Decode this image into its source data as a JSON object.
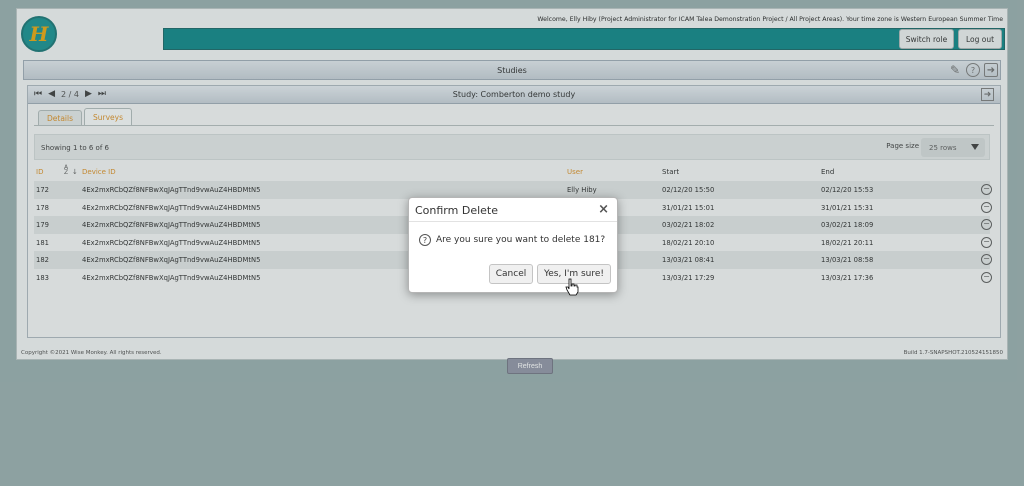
{
  "header": {
    "logo_letter": "H",
    "welcome": "Welcome, Elly Hiby (Project Administrator for ICAM Talea Demonstration Project / All Project Areas). Your time zone is Western European Summer Time",
    "switch_role": "Switch role",
    "logout": "Log out"
  },
  "panel": {
    "title": "Studies",
    "icons": [
      "pencil-icon",
      "help-icon",
      "exit-icon"
    ]
  },
  "study": {
    "pager_text": "2 / 4",
    "title": "Study: Comberton demo study"
  },
  "tabs": [
    {
      "label": "Details",
      "active": false
    },
    {
      "label": "Surveys",
      "active": true
    }
  ],
  "table": {
    "showing": "Showing 1 to 6 of 6",
    "page_size_label": "Page size",
    "page_size_value": "25 rows",
    "columns": [
      "ID",
      "Device ID",
      "User",
      "Start",
      "End"
    ],
    "rows": [
      {
        "id": "172",
        "device": "4Ex2mxRCbQZf8NFBwXqJAgTTnd9vwAuZ4HBDMtN5",
        "user": "Elly Hiby",
        "start": "02/12/20 15:50",
        "end": "02/12/20 15:53"
      },
      {
        "id": "178",
        "device": "4Ex2mxRCbQZf8NFBwXqJAgTTnd9vwAuZ4HBDMtN5",
        "user": "",
        "start": "31/01/21 15:01",
        "end": "31/01/21 15:31"
      },
      {
        "id": "179",
        "device": "4Ex2mxRCbQZf8NFBwXqJAgTTnd9vwAuZ4HBDMtN5",
        "user": "",
        "start": "03/02/21 18:02",
        "end": "03/02/21 18:09"
      },
      {
        "id": "181",
        "device": "4Ex2mxRCbQZf8NFBwXqJAgTTnd9vwAuZ4HBDMtN5",
        "user": "",
        "start": "18/02/21 20:10",
        "end": "18/02/21 20:11"
      },
      {
        "id": "182",
        "device": "4Ex2mxRCbQZf8NFBwXqJAgTTnd9vwAuZ4HBDMtN5",
        "user": "",
        "start": "13/03/21 08:41",
        "end": "13/03/21 08:58"
      },
      {
        "id": "183",
        "device": "4Ex2mxRCbQZf8NFBwXqJAgTTnd9vwAuZ4HBDMtN5",
        "user": "",
        "start": "13/03/21 17:29",
        "end": "13/03/21 17:36"
      }
    ],
    "refresh": "Refresh"
  },
  "footer": {
    "copyright": "Copyright ©2021 Wise Monkey. All rights reserved.",
    "build": "Build 1.7-SNAPSHOT.210524151850"
  },
  "dialog": {
    "title": "Confirm Delete",
    "close": "×",
    "message": "Are you sure you want to delete 181?",
    "cancel": "Cancel",
    "confirm": "Yes, I'm sure!"
  },
  "colors": {
    "teal": "#007f80",
    "accent_orange": "#d98a1a",
    "background": "#93aaaa"
  }
}
